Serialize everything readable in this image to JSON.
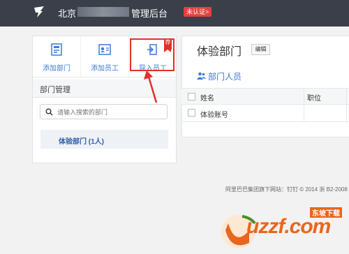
{
  "header": {
    "title_prefix": "北京",
    "title_suffix": "管理后台",
    "unverified_badge": "未认证>"
  },
  "actions": [
    {
      "label": "添加部门",
      "icon": "add-department-icon"
    },
    {
      "label": "添加员工",
      "icon": "add-employee-icon"
    },
    {
      "label": "导入员工",
      "icon": "import-employee-icon"
    }
  ],
  "ribbon_label": "荐",
  "department_management": {
    "title": "部门管理",
    "search_placeholder": "请输入搜索的部门",
    "departments": [
      {
        "label": "体验部门 (1人)"
      }
    ]
  },
  "department_detail": {
    "title": "体验部门",
    "edit_label": "编辑",
    "members_heading": "部门人员",
    "columns": [
      "姓名",
      "职位"
    ],
    "rows": [
      {
        "name": "体验账号",
        "position": ""
      }
    ]
  },
  "footer": "阿里巴巴集团旗下网站：钉钉 © 2014 浙 B2-2008",
  "watermark": {
    "brand": "uzzf.com",
    "tag": "东坡下载"
  },
  "colors": {
    "header_bg": "#3b3f4a",
    "accent": "#3a7bd5",
    "highlight": "#e0312a",
    "watermark": "#e8661d"
  }
}
